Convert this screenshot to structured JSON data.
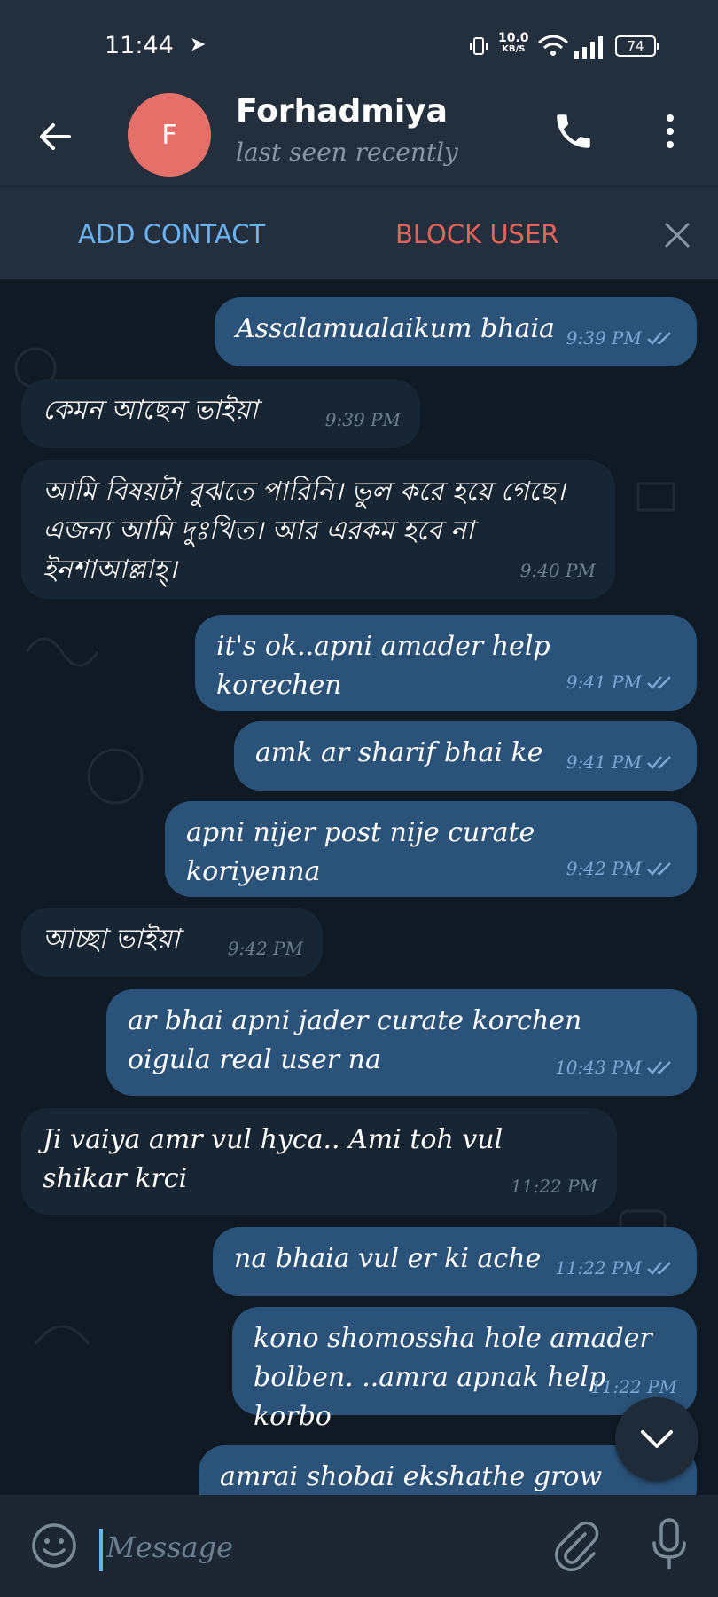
{
  "status_bar": {
    "time": "11:44",
    "net_speed_value": "10.0",
    "net_speed_unit": "KB/S",
    "battery": "74"
  },
  "header": {
    "avatar_letter": "F",
    "name": "Forhadmiya",
    "status": "last seen recently"
  },
  "actions": {
    "add_contact": "ADD CONTACT",
    "block_user": "BLOCK USER"
  },
  "messages": [
    {
      "text": "Assalamualaikum bhaia",
      "time": "9:39 PM",
      "direction": "out"
    },
    {
      "text": "কেমন আছেন ভাইয়া",
      "time": "9:39 PM",
      "direction": "in"
    },
    {
      "text": "আমি বিষয়টা বুঝতে পারিনি। ভুল করে হয়ে গেছে। এজন্য আমি দুঃখিত। আর এরকম হবে না ইনশাআল্লাহ্।",
      "time": "9:40 PM",
      "direction": "in"
    },
    {
      "text": "it's ok..apni amader help korechen",
      "time": "9:41 PM",
      "direction": "out"
    },
    {
      "text": "amk ar sharif bhai ke",
      "time": "9:41 PM",
      "direction": "out"
    },
    {
      "text": "apni nijer post nije curate koriyenna",
      "time": "9:42 PM",
      "direction": "out"
    },
    {
      "text": "আচ্ছা ভাইয়া",
      "time": "9:42 PM",
      "direction": "in"
    },
    {
      "text": "ar bhai apni jader curate korchen oigula real user na",
      "time": "10:43 PM",
      "direction": "out"
    },
    {
      "text": "Ji vaiya amr vul hyca.. Ami toh vul shikar krci",
      "time": "11:22 PM",
      "direction": "in"
    },
    {
      "text": "na bhaia vul er ki ache",
      "time": "11:22 PM",
      "direction": "out"
    },
    {
      "text": "kono shomossha hole amader bolben. ..amra apnak help korbo",
      "time": "11:22 PM",
      "direction": "out"
    },
    {
      "text": "amrai shobai ekshathe grow korbo",
      "time": "",
      "direction": "out"
    }
  ],
  "input": {
    "placeholder": "Message"
  },
  "colors": {
    "header_bg": "#242f3d",
    "chat_bg": "#0f1a24",
    "outgoing_bubble": "#2b5278",
    "incoming_bubble": "#182533",
    "accent": "#6ab2f2",
    "danger": "#e5635a",
    "avatar": "#e5706a"
  },
  "icons": [
    "back-arrow-icon",
    "phone-icon",
    "more-vert-icon",
    "close-icon",
    "double-check-icon",
    "chevron-down-icon",
    "emoji-icon",
    "paperclip-icon",
    "mic-icon"
  ]
}
